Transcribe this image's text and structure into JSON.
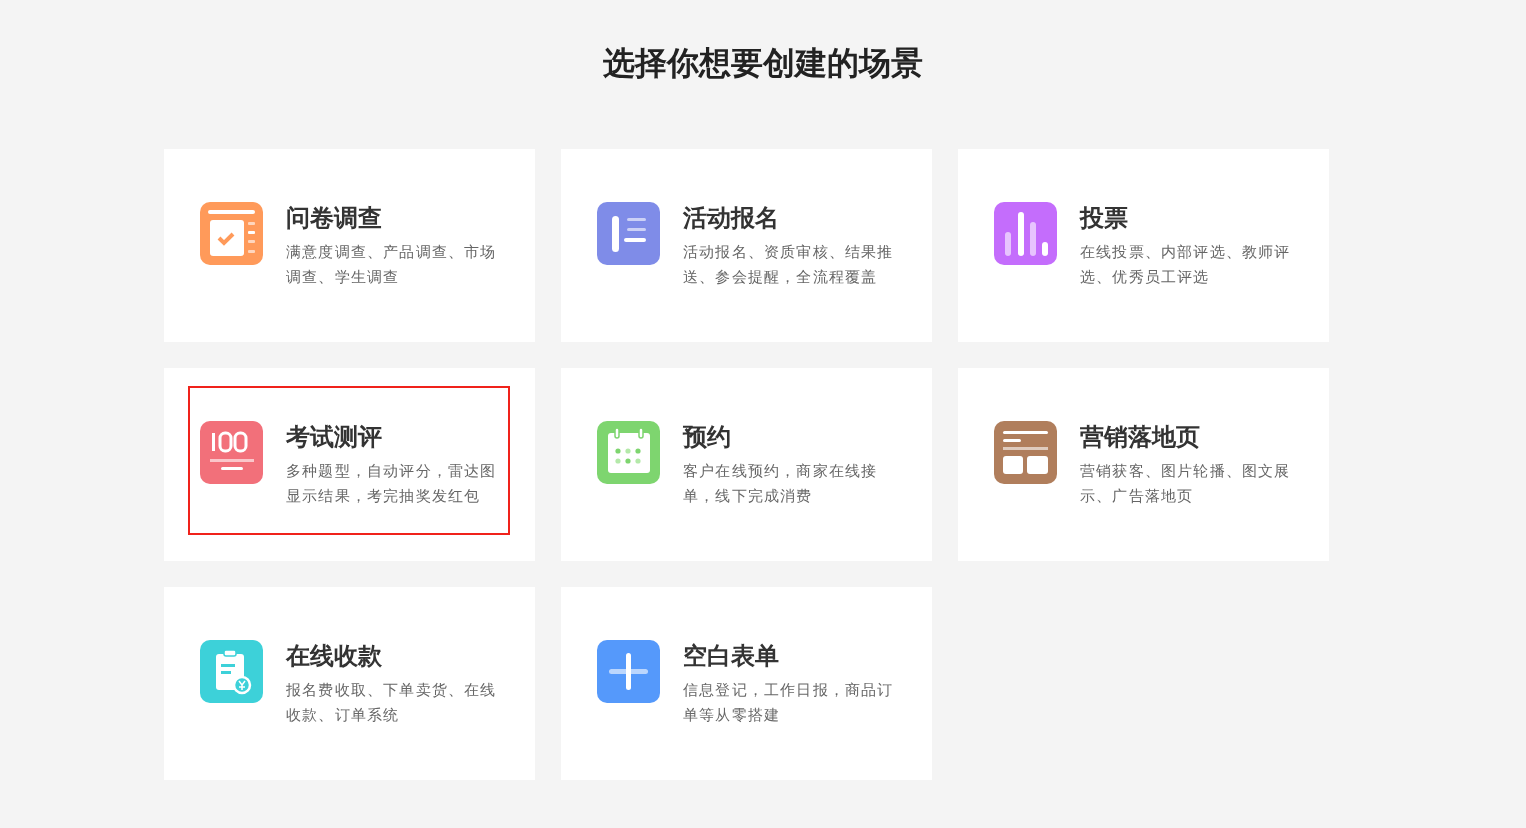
{
  "heading": "选择你想要创建的场景",
  "cards": [
    {
      "kind": "survey",
      "color": "#ff9a5a",
      "title": "问卷调查",
      "description": "满意度调查、产品调查、市场调查、学生调查",
      "selected": false
    },
    {
      "kind": "signup",
      "color": "#7f8ce8",
      "title": "活动报名",
      "description": "活动报名、资质审核、结果推送、参会提醒，全流程覆盖",
      "selected": false
    },
    {
      "kind": "vote",
      "color": "#c46dfc",
      "title": "投票",
      "description": "在线投票、内部评选、教师评选、优秀员工评选",
      "selected": false
    },
    {
      "kind": "exam",
      "color": "#f2707a",
      "title": "考试测评",
      "description": "多种题型，自动评分，雷达图显示结果，考完抽奖发红包",
      "selected": true
    },
    {
      "kind": "booking",
      "color": "#7ed56f",
      "title": "预约",
      "description": "客户在线预约，商家在线接单，线下完成消费",
      "selected": false
    },
    {
      "kind": "landing",
      "color": "#b07e5c",
      "title": "营销落地页",
      "description": "营销获客、图片轮播、图文展示、广告落地页",
      "selected": false
    },
    {
      "kind": "payment",
      "color": "#3dd1d9",
      "title": "在线收款",
      "description": "报名费收取、下单卖货、在线收款、订单系统",
      "selected": false
    },
    {
      "kind": "blank",
      "color": "#5599fb",
      "title": "空白表单",
      "description": "信息登记，工作日报，商品订单等从零搭建",
      "selected": false
    }
  ]
}
